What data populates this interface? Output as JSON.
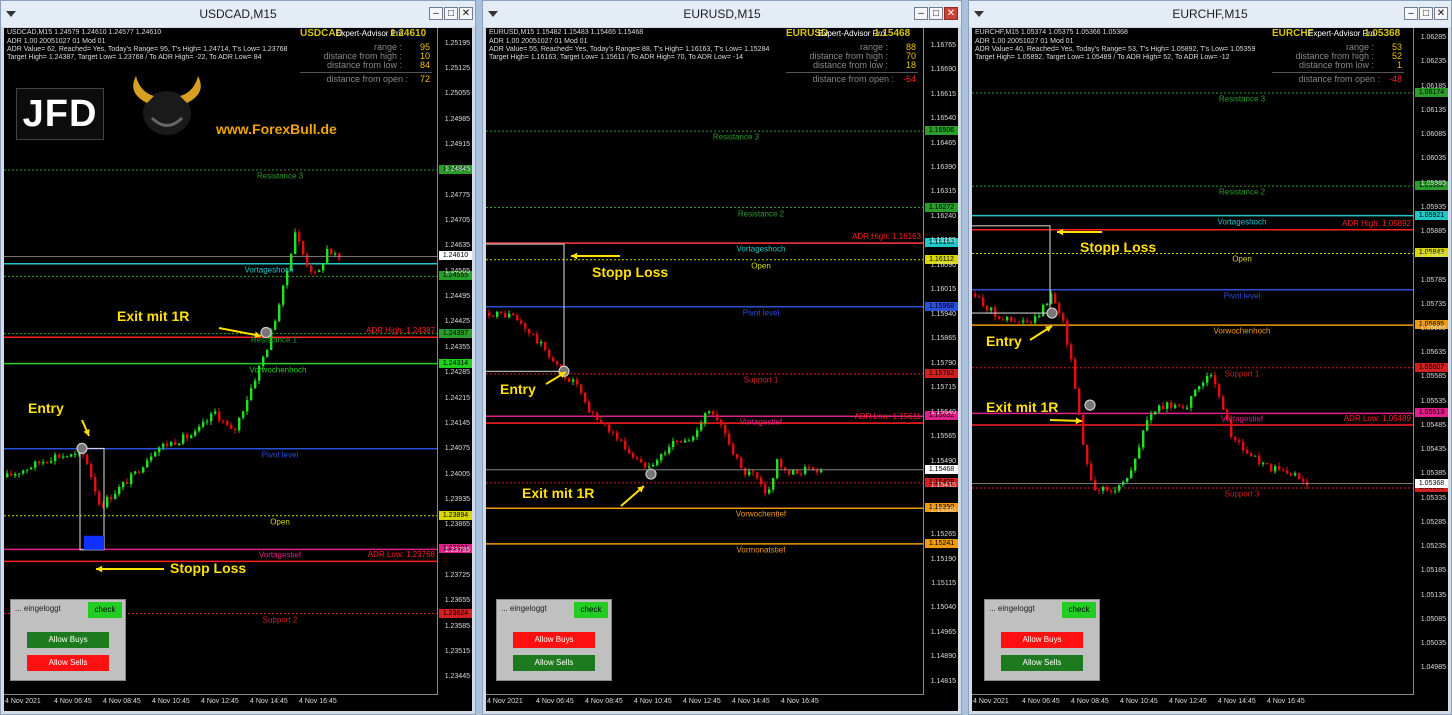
{
  "colors": {
    "bull": "#22e022",
    "bear": "#e01010",
    "resistance": "#2a9d2a",
    "support": "#d02020",
    "pivot": "#2a4fd8",
    "open": "#d8d800",
    "adr_high": "#ff2020",
    "adr_low": "#ff2020",
    "vortageshoch": "#20c8c8",
    "vorwochenhoch": "#20d020",
    "vortagestief": "#e0208a",
    "vorwochentief": "#f09a10",
    "allow_buys_active": "#1e7a1e",
    "allow_sells_inactive": "#ff1010",
    "accent_yellow": "#ffe000"
  },
  "windows": [
    {
      "title": "USDCAD,M15",
      "symbol_line": "USDCAD,M15  1.24579 1.24610 1.24577 1.24610",
      "info_lines": [
        "ADR 1.00 20051027 01 Mod 01",
        "ADR Value= 62, Reached= Yes, Today's Range= 95, T's High= 1.24714, T's Low= 1.23768",
        "Target High= 1.24387, Target Low= 1.23768 / To ADR High= -22, To ADR Low= 84"
      ],
      "ea_title": "Expert-Advisor Pro",
      "ea_symbol": "USDCAD",
      "big_price": "1.24610",
      "stats": [
        {
          "label": "range :",
          "value": "95",
          "red": false
        },
        {
          "label": "distance from high :",
          "value": "10",
          "red": false
        },
        {
          "label": "distance from low :",
          "value": "84",
          "red": false
        }
      ],
      "open_stat": {
        "label": "distance from open :",
        "value": "72",
        "red": false
      },
      "price_range": [
        1.2341,
        1.2523
      ],
      "y_ticks": [
        "1.25195",
        "1.25125",
        "1.25055",
        "1.24985",
        "1.24915",
        "1.24845",
        "1.24775",
        "1.24705",
        "1.24635",
        "1.24565",
        "1.24495",
        "1.24425",
        "1.24355",
        "1.24285",
        "1.24215",
        "1.24145",
        "1.24075",
        "1.24005",
        "1.23935",
        "1.23865",
        "1.23795",
        "1.23725",
        "1.23655",
        "1.23585",
        "1.23515",
        "1.23445"
      ],
      "x_ticks": [
        "4 Nov 2021",
        "4 Nov 06:45",
        "4 Nov 08:45",
        "4 Nov 10:45",
        "4 Nov 12:45",
        "4 Nov 14:45",
        "4 Nov 16:45"
      ],
      "levels": [
        {
          "name": "Resistance 3",
          "price": 1.24849,
          "color": "#2a9d2a",
          "dash": true,
          "tag": "1.24849"
        },
        {
          "name": "Vortageshoch",
          "price": 1.2459,
          "color": "#20c8c8",
          "dash": false,
          "tag": ""
        },
        {
          "name": "",
          "price": 1.24555,
          "color": "#2a9d2a",
          "dash": true,
          "tag": "1.24555"
        },
        {
          "name": "Resistance 1",
          "price": 1.24397,
          "color": "#2a9d2a",
          "dash": true,
          "tag": "1.24397"
        },
        {
          "name": "ADR High: 1.24387",
          "price": 1.24387,
          "color": "#ff2020",
          "dash": false,
          "adr": true,
          "tag": ""
        },
        {
          "name": "Vorwochenhoch",
          "price": 1.24314,
          "color": "#20d020",
          "dash": false,
          "tag": "1.24314"
        },
        {
          "name": "Pivot level",
          "price": 1.24079,
          "color": "#2a4fd8",
          "dash": false,
          "tag": ""
        },
        {
          "name": "Open",
          "price": 1.23894,
          "color": "#d8d800",
          "dash": true,
          "tag": "1.23894"
        },
        {
          "name": "Vortagestief",
          "price": 1.23801,
          "color": "#e0208a",
          "dash": false,
          "tag": "1.23801"
        },
        {
          "name": "ADR Low: 1.23768",
          "price": 1.23768,
          "color": "#ff2020",
          "dash": false,
          "adr": true,
          "tag": ""
        },
        {
          "name": "Support 2",
          "price": 1.23624,
          "color": "#d02020",
          "dash": true,
          "tag": "1.23624"
        }
      ],
      "annotations": [
        {
          "text": "Exit mit 1R"
        },
        {
          "text": "Entry"
        },
        {
          "text": "Stopp Loss"
        }
      ],
      "current_price_tag": "1.24610",
      "logo_text": "JFD",
      "website": "www.ForexBull.de",
      "panel": {
        "login_label": "eingeloggt",
        "check_label": "check",
        "buys_label": "Allow Buys",
        "sells_label": "Allow Sells",
        "buys_active": true,
        "sells_active": false
      }
    },
    {
      "title": "EURUSD,M15",
      "symbol_line": "EURUSD,M15  1.15482 1.15483 1.15465 1.15468",
      "info_lines": [
        "ADR 1.00 20051027 01 Mod 01",
        "ADR Value= 55, Reached= Yes, Today's Range= 88, T's High= 1.16163, T's Low= 1.15284",
        "Target High= 1.16163, Target Low= 1.15611 / To ADR High= 70, To ADR Low= -14"
      ],
      "ea_title": "Expert-Advisor Pro",
      "ea_symbol": "EURUSD",
      "big_price": "1.15468",
      "stats": [
        {
          "label": "range :",
          "value": "88",
          "red": false
        },
        {
          "label": "distance from high :",
          "value": "70",
          "red": false
        },
        {
          "label": "distance from low :",
          "value": "18",
          "red": false
        }
      ],
      "open_stat": {
        "label": "distance from open :",
        "value": "-64",
        "red": true
      },
      "price_range": [
        1.1479,
        1.1681
      ],
      "y_ticks": [
        "1.16765",
        "1.16690",
        "1.16615",
        "1.16540",
        "1.16465",
        "1.16390",
        "1.16315",
        "1.16240",
        "1.16165",
        "1.16090",
        "1.16015",
        "1.15940",
        "1.15865",
        "1.15790",
        "1.15715",
        "1.15640",
        "1.15565",
        "1.15490",
        "1.15415",
        "1.15340",
        "1.15265",
        "1.15190",
        "1.15115",
        "1.15040",
        "1.14965",
        "1.14890",
        "1.14815"
      ],
      "x_ticks": [
        "4 Nov 2021",
        "4 Nov 06:45",
        "4 Nov 08:45",
        "4 Nov 10:45",
        "4 Nov 12:45",
        "4 Nov 14:45",
        "4 Nov 16:45"
      ],
      "levels": [
        {
          "name": "Resistance 3",
          "price": 1.16506,
          "color": "#2a9d2a",
          "dash": true,
          "tag": "1.16506"
        },
        {
          "name": "Resistance 2",
          "price": 1.16272,
          "color": "#2a9d2a",
          "dash": true,
          "tag": "1.16272"
        },
        {
          "name": "Vortageshoch",
          "price": 1.16163,
          "color": "#20c8c8",
          "dash": false,
          "tag": "1.16163"
        },
        {
          "name": "ADR High: 1.16163",
          "price": 1.16163,
          "color": "#ff2020",
          "dash": false,
          "adr": true,
          "tag": ""
        },
        {
          "name": "Open",
          "price": 1.16112,
          "color": "#d8d800",
          "dash": true,
          "tag": "1.16112"
        },
        {
          "name": "Pivot level",
          "price": 1.15968,
          "color": "#2a4fd8",
          "dash": false,
          "tag": "1.15968"
        },
        {
          "name": "Support 1",
          "price": 1.15762,
          "color": "#d02020",
          "dash": true,
          "tag": "1.15762"
        },
        {
          "name": "Vortagestief",
          "price": 1.15632,
          "color": "#e0208a",
          "dash": false,
          "tag": "1.15632"
        },
        {
          "name": "ADR Low: 1.15611",
          "price": 1.15611,
          "color": "#ff2020",
          "dash": false,
          "adr": true,
          "tag": ""
        },
        {
          "name": "",
          "price": 1.15428,
          "color": "#d02020",
          "dash": true,
          "tag": "1.15428"
        },
        {
          "name": "Vorwochentief",
          "price": 1.1535,
          "color": "#f09a10",
          "dash": false,
          "tag": "1.15350"
        },
        {
          "name": "Vormonatstief",
          "price": 1.15241,
          "color": "#f09a10",
          "dash": false,
          "tag": "1.15241"
        }
      ],
      "annotations": [
        {
          "text": "Stopp Loss"
        },
        {
          "text": "Entry"
        },
        {
          "text": "Exit mit 1R"
        }
      ],
      "current_price_tag": "1.15468",
      "panel": {
        "login_label": "eingeloggt",
        "check_label": "check",
        "buys_label": "Allow Buys",
        "sells_label": "Allow Sells",
        "buys_active": false,
        "sells_active": true
      }
    },
    {
      "title": "EURCHF,M15",
      "symbol_line": "EURCHF,M15  1.05374 1.05375 1.05366 1.05368",
      "info_lines": [
        "ADR 1.00 20051027 01 Mod 01",
        "ADR Value= 40, Reached= Yes, Today's Range= 53, T's High= 1.05892, T's Low= 1.05359",
        "Target High= 1.05892, Target Low= 1.05489 / To ADR High= 52, To ADR Low= -12"
      ],
      "ea_title": "Expert-Advisor Pro",
      "ea_symbol": "EURCHF",
      "big_price": "1.05368",
      "stats": [
        {
          "label": "range :",
          "value": "53",
          "red": false
        },
        {
          "label": "distance from high :",
          "value": "52",
          "red": false
        },
        {
          "label": "distance from low :",
          "value": "1",
          "red": false
        }
      ],
      "open_stat": {
        "label": "distance from open :",
        "value": "-48",
        "red": true
      },
      "price_range": [
        1.0494,
        1.063
      ],
      "y_ticks": [
        "1.06285",
        "1.06235",
        "1.06185",
        "1.06135",
        "1.06085",
        "1.06035",
        "1.05985",
        "1.05935",
        "1.05885",
        "1.05835",
        "1.05785",
        "1.05735",
        "1.05685",
        "1.05635",
        "1.05585",
        "1.05535",
        "1.05485",
        "1.05435",
        "1.05385",
        "1.05335",
        "1.05285",
        "1.05235",
        "1.05185",
        "1.05135",
        "1.05085",
        "1.05035",
        "1.04985"
      ],
      "x_ticks": [
        "4 Nov 2021",
        "4 Nov 06:45",
        "4 Nov 08:45",
        "4 Nov 10:45",
        "4 Nov 12:45",
        "4 Nov 14:45",
        "4 Nov 16:45"
      ],
      "levels": [
        {
          "name": "Resistance 3",
          "price": 1.06174,
          "color": "#2a9d2a",
          "dash": true,
          "tag": "1.06174"
        },
        {
          "name": "Resistance 2",
          "price": 1.05982,
          "color": "#2a9d2a",
          "dash": true,
          "tag": "1.05982"
        },
        {
          "name": "Vortageshoch",
          "price": 1.05921,
          "color": "#20c8c8",
          "dash": false,
          "tag": "1.05921"
        },
        {
          "name": "ADR High: 1.05892",
          "price": 1.05892,
          "color": "#ff2020",
          "dash": false,
          "adr": true,
          "tag": ""
        },
        {
          "name": "Open",
          "price": 1.05843,
          "color": "#d8d800",
          "dash": true,
          "tag": "1.05843"
        },
        {
          "name": "Pivot level",
          "price": 1.05768,
          "color": "#2a4fd8",
          "dash": false,
          "tag": ""
        },
        {
          "name": "Vorwochenhoch",
          "price": 1.05695,
          "color": "#f09a10",
          "dash": false,
          "tag": "1.05695"
        },
        {
          "name": "Support 1",
          "price": 1.05607,
          "color": "#d02020",
          "dash": true,
          "tag": "1.05607"
        },
        {
          "name": "Vortagestief",
          "price": 1.05513,
          "color": "#e0208a",
          "dash": false,
          "tag": "1.05513"
        },
        {
          "name": "ADR Low: 1.05489",
          "price": 1.05489,
          "color": "#ff2020",
          "dash": false,
          "adr": true,
          "tag": ""
        },
        {
          "name": "Support 3",
          "price": 1.05359,
          "color": "#d02020",
          "dash": true,
          "tag": "1.05359"
        }
      ],
      "annotations": [
        {
          "text": "Stopp Loss"
        },
        {
          "text": "Entry"
        },
        {
          "text": "Exit mit 1R"
        }
      ],
      "current_price_tag": "1.05368",
      "panel": {
        "login_label": "eingeloggt",
        "check_label": "check",
        "buys_label": "Allow Buys",
        "sells_label": "Allow Sells",
        "buys_active": false,
        "sells_active": true
      }
    }
  ]
}
